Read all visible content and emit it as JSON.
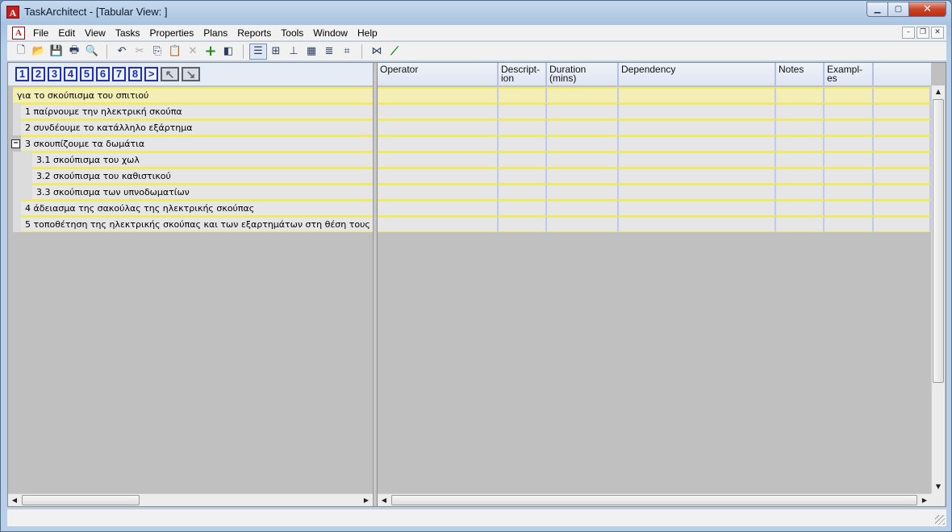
{
  "window": {
    "title": "TaskArchitect - [Tabular View: ]",
    "controls": {
      "minimize": "▁",
      "maximize": "▢",
      "close": "✕"
    },
    "app_icon_letter": "A"
  },
  "menubar": {
    "items": [
      "File",
      "Edit",
      "View",
      "Tasks",
      "Properties",
      "Plans",
      "Reports",
      "Tools",
      "Window",
      "Help"
    ],
    "mdi_controls": {
      "minimize": "–",
      "restore": "❐",
      "close": "✕"
    }
  },
  "toolbar": {
    "buttons": [
      {
        "name": "new-icon",
        "glyph": "🗋"
      },
      {
        "name": "open-icon",
        "glyph": "📂"
      },
      {
        "name": "save-icon",
        "glyph": "💾"
      },
      {
        "name": "print-icon",
        "glyph": "🖶"
      },
      {
        "name": "find-icon",
        "glyph": "🔍"
      },
      {
        "name": "undo-icon",
        "glyph": "↶"
      },
      {
        "name": "cut-icon",
        "glyph": "✂"
      },
      {
        "name": "copy-icon",
        "glyph": "⎘"
      },
      {
        "name": "paste-icon",
        "glyph": "📋"
      },
      {
        "name": "delete-icon",
        "glyph": "✕"
      },
      {
        "name": "add-task-icon",
        "glyph": "+"
      },
      {
        "name": "panel-toggle-icon",
        "glyph": "◧"
      },
      {
        "name": "tabular-view-icon",
        "glyph": "☰"
      },
      {
        "name": "tree-view-icon",
        "glyph": "⊞"
      },
      {
        "name": "hierarchy-view-icon",
        "glyph": "⊥"
      },
      {
        "name": "grid-view-icon",
        "glyph": "▦"
      },
      {
        "name": "outline-view-icon",
        "glyph": "≣"
      },
      {
        "name": "chart-view-icon",
        "glyph": "⌗"
      },
      {
        "name": "timeline-icon",
        "glyph": "⋈"
      },
      {
        "name": "diagram-icon",
        "glyph": "⟋"
      }
    ]
  },
  "level_bar": {
    "levels": [
      "1",
      "2",
      "3",
      "4",
      "5",
      "6",
      "7",
      "8",
      ">"
    ],
    "promote": "↖",
    "demote": "↘"
  },
  "tasks": [
    {
      "label": "για το σκούπισμα του σπιτιού",
      "level": 0
    },
    {
      "label": "1 παίρνουμε την ηλεκτρική σκούπα",
      "level": 1
    },
    {
      "label": "2 συνδέουμε το κατάλληλο εξάρτημα",
      "level": 1
    },
    {
      "label": "3 σκουπίζουμε τα δωμάτια",
      "level": 1,
      "collapsible": true
    },
    {
      "label": "3.1 σκούπισμα του χωλ",
      "level": 2
    },
    {
      "label": "3.2 σκούπισμα του καθιστικού",
      "level": 2
    },
    {
      "label": "3.3 σκούπισμα των υπνοδωματίων",
      "level": 2
    },
    {
      "label": "4 άδειασμα της σακούλας της ηλεκτρικής σκούπας",
      "level": 1
    },
    {
      "label": "5 τοποθέτηση της ηλεκτρικής σκούπας και των εξαρτημάτων στη θέση τους",
      "level": 1
    }
  ],
  "columns": [
    {
      "label": "Operator"
    },
    {
      "label": "Descript-\nion"
    },
    {
      "label": "Duration\n(mins)"
    },
    {
      "label": "Dependency"
    },
    {
      "label": "Notes"
    },
    {
      "label": "Exampl-\nes"
    },
    {
      "label": ""
    }
  ],
  "scroll": {
    "up": "▲",
    "down": "▼",
    "left": "◀",
    "right": "▶"
  },
  "colors": {
    "row_highlight": "#f0ea6a",
    "root_row": "#f2eeb6",
    "level_blue": "#1f2fb5"
  }
}
